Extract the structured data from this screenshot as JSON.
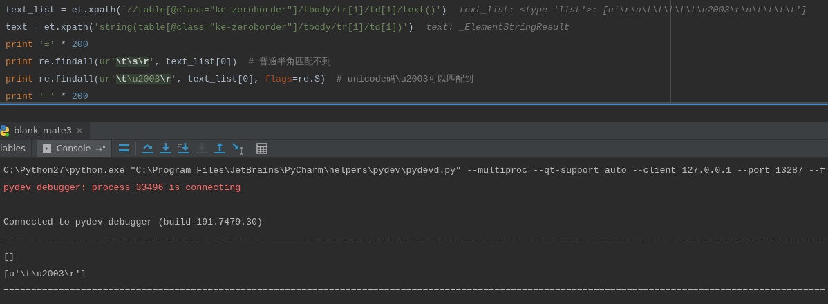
{
  "editor": {
    "lines": [
      {
        "tokens": [
          {
            "kind": "plain",
            "text": "text_list = et.xpath("
          },
          {
            "kind": "string",
            "text": "'//table[@class=\"ke-zeroborder\"]/tbody/tr[1]/td[1]/text()'"
          },
          {
            "kind": "plain",
            "text": ")"
          }
        ],
        "hint": "text_list: <type 'list'>: [u'\\r\\n\\t\\t\\t\\t\\t\\u2003\\r\\n\\t\\t\\t\\t']"
      },
      {
        "tokens": [
          {
            "kind": "plain",
            "text": "text = et.xpath("
          },
          {
            "kind": "string",
            "text": "'string(table[@class=\"ke-zeroborder\"]/tbody/tr[1]/td[1])'"
          },
          {
            "kind": "plain",
            "text": ")"
          }
        ],
        "hint": "text: _ElementStringResult"
      },
      {
        "tokens": [
          {
            "kind": "keyword",
            "text": "print "
          },
          {
            "kind": "string",
            "text": "'='"
          },
          {
            "kind": "plain",
            "text": " * "
          },
          {
            "kind": "number",
            "text": "200"
          }
        ]
      },
      {
        "tokens": [
          {
            "kind": "keyword",
            "text": "print"
          },
          {
            "kind": "plain",
            "text": " re.findall("
          },
          {
            "kind": "string",
            "text": "ur'"
          },
          {
            "kind": "escape",
            "text": "\\t\\s\\r"
          },
          {
            "kind": "string",
            "text": "'"
          },
          {
            "kind": "plain",
            "text": ", text_list[0])  "
          },
          {
            "kind": "comment",
            "text": "# 普通半角匹配不到"
          }
        ]
      },
      {
        "tokens": [
          {
            "kind": "keyword",
            "text": "print"
          },
          {
            "kind": "plain",
            "text": " re.findall("
          },
          {
            "kind": "string",
            "text": "ur'"
          },
          {
            "kind": "escape",
            "text": "\\t"
          },
          {
            "kind": "escape_dim",
            "text": "\\u2003"
          },
          {
            "kind": "escape",
            "text": "\\r"
          },
          {
            "kind": "string",
            "text": "'"
          },
          {
            "kind": "plain",
            "text": ", text_list[0], "
          },
          {
            "kind": "param",
            "text": "flags"
          },
          {
            "kind": "plain",
            "text": "=re.S)  "
          },
          {
            "kind": "comment",
            "text": "# unicode码\\u2003可以匹配到"
          }
        ]
      },
      {
        "tokens": [
          {
            "kind": "keyword",
            "text": "print "
          },
          {
            "kind": "string",
            "text": "'='"
          },
          {
            "kind": "plain",
            "text": " * "
          },
          {
            "kind": "number",
            "text": "200"
          }
        ]
      }
    ]
  },
  "run_tab": {
    "title": "blank_mate3"
  },
  "toolbar": {
    "tabs": [
      {
        "label": "iables",
        "selected": false
      },
      {
        "label": "Console",
        "selected": true
      }
    ],
    "buttons": [
      {
        "kind": "menu",
        "disabled": false
      },
      {
        "kind": "step-over",
        "disabled": false
      },
      {
        "kind": "step-into",
        "disabled": false
      },
      {
        "kind": "step-into-my-code",
        "disabled": false
      },
      {
        "kind": "force-step-into",
        "disabled": true
      },
      {
        "kind": "step-out",
        "disabled": false
      },
      {
        "kind": "run-to-cursor",
        "disabled": false
      },
      {
        "kind": "table",
        "disabled": false
      }
    ]
  },
  "console": {
    "lines": [
      {
        "kind": "stdout",
        "text": "C:\\Python27\\python.exe \"C:\\Program Files\\JetBrains\\PyCharm\\helpers\\pydev\\pydevd.py\" --multiproc --qt-support=auto --client 127.0.0.1 --port 13287 --f"
      },
      {
        "kind": "stderr",
        "text": "pydev debugger: process 33496 is connecting"
      },
      {
        "kind": "blank"
      },
      {
        "kind": "stdout",
        "text": "Connected to pydev debugger (build 191.7479.30)"
      },
      {
        "kind": "stdout",
        "text": "====================================================================================================================================================="
      },
      {
        "kind": "stdout",
        "text": "[]"
      },
      {
        "kind": "stdout",
        "text": "[u'\\t\\u2003\\r']"
      },
      {
        "kind": "stdout",
        "text": "====================================================================================================================================================="
      }
    ]
  }
}
